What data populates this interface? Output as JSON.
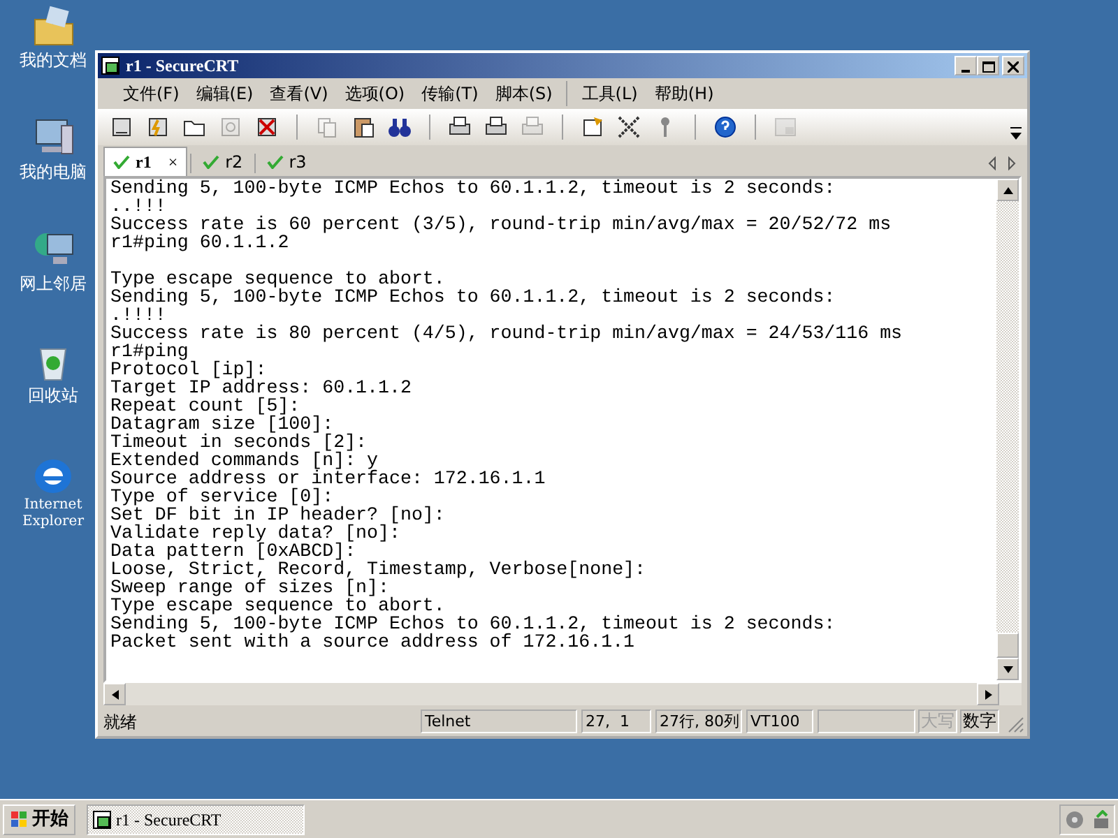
{
  "desktop_icons": [
    {
      "kind": "folder",
      "label": "我的文档"
    },
    {
      "kind": "computer",
      "label": "我的电脑"
    },
    {
      "kind": "network",
      "label": "网上邻居"
    },
    {
      "kind": "recycle",
      "label": "回收站"
    },
    {
      "kind": "browser",
      "label": "Internet Explorer"
    }
  ],
  "window": {
    "title": "r1 - SecureCRT"
  },
  "menu": [
    "文件(F)",
    "编辑(E)",
    "查看(V)",
    "选项(O)",
    "传输(T)",
    "脚本(S)",
    "工具(L)",
    "帮助(H)"
  ],
  "toolbar": [
    {
      "kind": "connect",
      "disabled": false
    },
    {
      "kind": "quick",
      "disabled": false
    },
    {
      "kind": "folder",
      "disabled": false
    },
    {
      "kind": "reconnect",
      "disabled": true
    },
    {
      "kind": "disconnect",
      "disabled": false
    },
    {
      "kind": "sep"
    },
    {
      "kind": "copy",
      "disabled": true
    },
    {
      "kind": "paste",
      "disabled": false
    },
    {
      "kind": "find",
      "disabled": false
    },
    {
      "kind": "sep"
    },
    {
      "kind": "print",
      "disabled": false
    },
    {
      "kind": "print",
      "disabled": false
    },
    {
      "kind": "print",
      "disabled": true
    },
    {
      "kind": "sep"
    },
    {
      "kind": "options",
      "disabled": false
    },
    {
      "kind": "keymap",
      "disabled": false
    },
    {
      "kind": "key",
      "disabled": false
    },
    {
      "kind": "sep"
    },
    {
      "kind": "help",
      "disabled": false
    },
    {
      "kind": "sep"
    },
    {
      "kind": "sftp",
      "disabled": true
    }
  ],
  "tabs": [
    {
      "label": "r1",
      "selected": true,
      "close": "×"
    },
    {
      "label": "r2",
      "selected": false
    },
    {
      "label": "r3",
      "selected": false
    }
  ],
  "terminal_lines": [
    "Sending 5, 100-byte ICMP Echos to 60.1.1.2, timeout is 2 seconds:",
    "..!!!",
    "Success rate is 60 percent (3/5), round-trip min/avg/max = 20/52/72 ms",
    "r1#ping 60.1.1.2",
    "Type escape sequence to abort.",
    "Sending 5, 100-byte ICMP Echos to 60.1.1.2, timeout is 2 seconds:",
    ".!!!!",
    "Success rate is 80 percent (4/5), round-trip min/avg/max = 24/53/116 ms",
    "r1#ping",
    "Protocol [ip]:",
    "Target IP address: 60.1.1.2",
    "Repeat count [5]:",
    "Datagram size [100]:",
    "Timeout in seconds [2]:",
    "Extended commands [n]: y",
    "Source address or interface: 172.16.1.1",
    "Type of service [0]:",
    "Set DF bit in IP header? [no]:",
    "Validate reply data? [no]:",
    "Data pattern [0xABCD]:",
    "Loose, Strict, Record, Timestamp, Verbose[none]:",
    "Sweep range of sizes [n]:",
    "Type escape sequence to abort.",
    "Sending 5, 100-byte ICMP Echos to 60.1.1.2, timeout is 2 seconds:",
    "Packet sent with a source address of 172.16.1.1"
  ],
  "status_bar": {
    "message": "就绪",
    "panes": [
      "Telnet",
      "27,  1",
      "27行, 80列",
      "VT100"
    ],
    "indicators": [
      {
        "label": "大写",
        "on": false
      },
      {
        "label": "数字",
        "on": true
      }
    ]
  },
  "taskbar": {
    "start": "开始",
    "tasks": [
      "r1 - SecureCRT"
    ]
  }
}
